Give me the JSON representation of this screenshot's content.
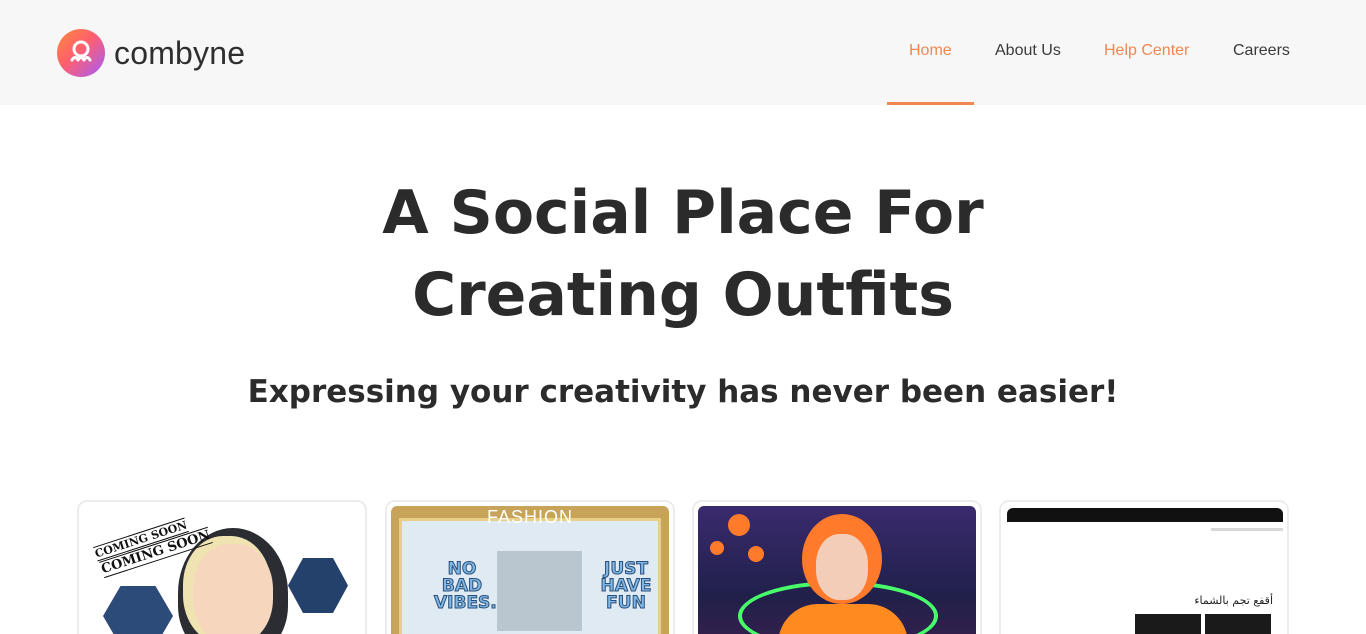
{
  "brand": {
    "name": "combyne",
    "logo_icon": "octopus-logo-icon"
  },
  "nav": {
    "items": [
      {
        "label": "Home",
        "active": true
      },
      {
        "label": "About Us"
      },
      {
        "label": "Help Center"
      },
      {
        "label": "Careers"
      }
    ],
    "accent_color": "#f0874f"
  },
  "hero": {
    "title_line1": "A Social Place For",
    "title_line2": "Creating Outfits",
    "subtitle": "Expressing your creativity has never been easier!"
  },
  "cards": [
    {
      "stamp_top": "COMING SOON",
      "stamp_bottom": "COMING SOON"
    },
    {
      "frame_title": "FASHION",
      "badge_left": "NO BAD VIBES.",
      "badge_right": "JUST HAVE FUN"
    },
    {},
    {
      "caption": "أقفع تجم بالشماء"
    }
  ]
}
